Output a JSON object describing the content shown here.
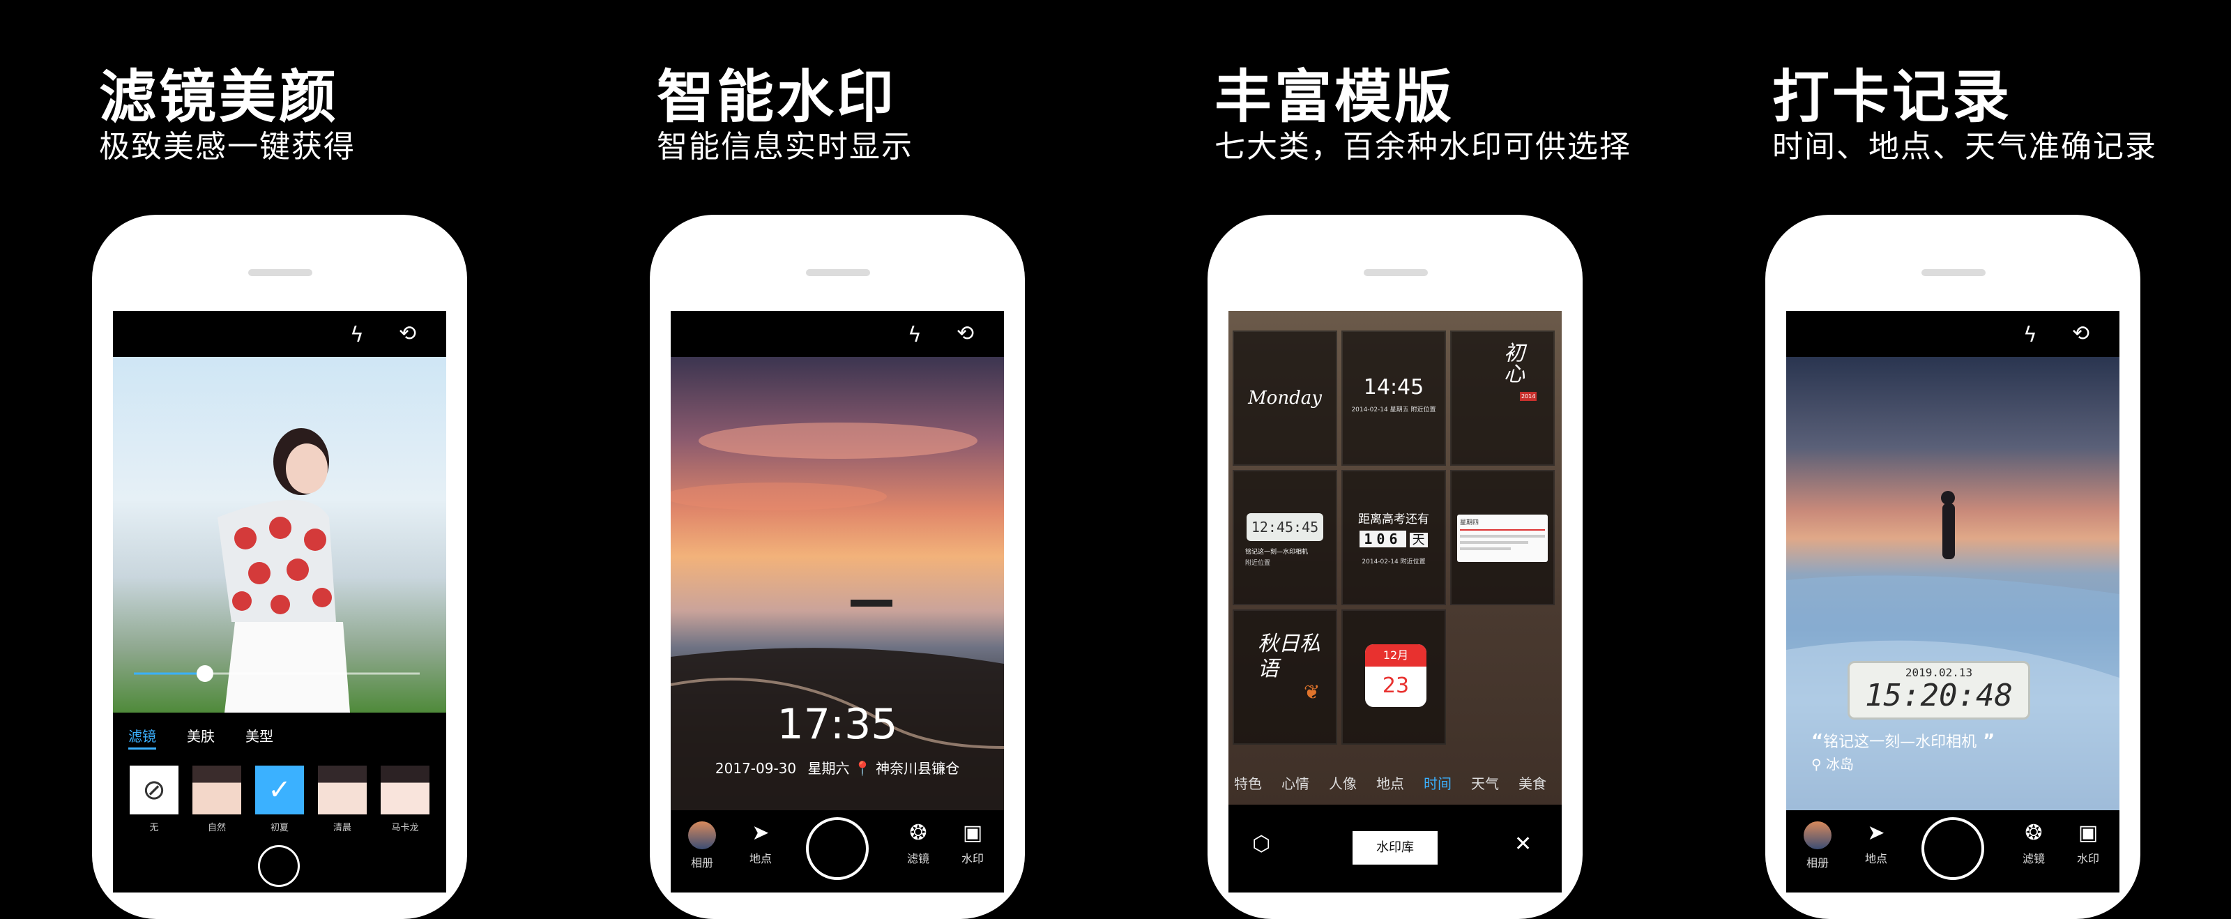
{
  "panels": [
    {
      "title": "滤镜美颜",
      "subtitle": "极致美感一键获得",
      "tabs": [
        "滤镜",
        "美肤",
        "美型"
      ],
      "filters": [
        {
          "label": "无",
          "icon": "⊘"
        },
        {
          "label": "自然",
          "icon": ""
        },
        {
          "label": "初夏",
          "icon": "✓"
        },
        {
          "label": "清晨",
          "icon": ""
        },
        {
          "label": "马卡龙",
          "icon": ""
        }
      ],
      "slider_level": 0.25
    },
    {
      "title": "智能水印",
      "subtitle": "智能信息实时显示",
      "watermark_time": "17:35",
      "watermark_date": "2017-09-30",
      "watermark_weekday": "星期六",
      "watermark_location": "神奈川县镰仓",
      "bottom_bar": [
        "相册",
        "地点",
        "滤镜",
        "水印"
      ]
    },
    {
      "title": "丰富模版",
      "subtitle": "七大类，百余种水印可供选择",
      "tiles": {
        "monday": "Monday",
        "clock_time": "14:45",
        "clock_date": "2014-02-14",
        "clock_weekday": "星期五",
        "clock_loc": "附近位置",
        "poem_title": "初心",
        "poem_stamp": "2014",
        "digital_clock": "12:45:45",
        "digital_caption": "铭记这一刻—水印相机",
        "digital_loc": "附近位置",
        "exam_title": "距离高考还有",
        "exam_digits": "106",
        "exam_unit": "天",
        "exam_date": "2014-02-14",
        "exam_loc": "附近位置",
        "weekday_note": "星期四",
        "autumn": "秋日私语",
        "calendar_month": "12月",
        "calendar_day": "23"
      },
      "categories": [
        "特色",
        "心情",
        "人像",
        "地点",
        "时间",
        "天气",
        "美食"
      ],
      "active_category": "时间",
      "library_button": "水印库"
    },
    {
      "title": "打卡记录",
      "subtitle": "时间、地点、天气准确记录",
      "clock_date": "2019.02.13",
      "clock_time": "15:20:48",
      "caption": "铭记这一刻—水印相机",
      "location": "冰岛",
      "bottom_bar": [
        "相册",
        "地点",
        "滤镜",
        "水印"
      ]
    }
  ],
  "icons": {
    "flash": "flash-off-icon",
    "switch": "switch-camera-icon"
  },
  "colors": {
    "accent": "#3bb1ff",
    "calendar_red": "#e8312f"
  }
}
